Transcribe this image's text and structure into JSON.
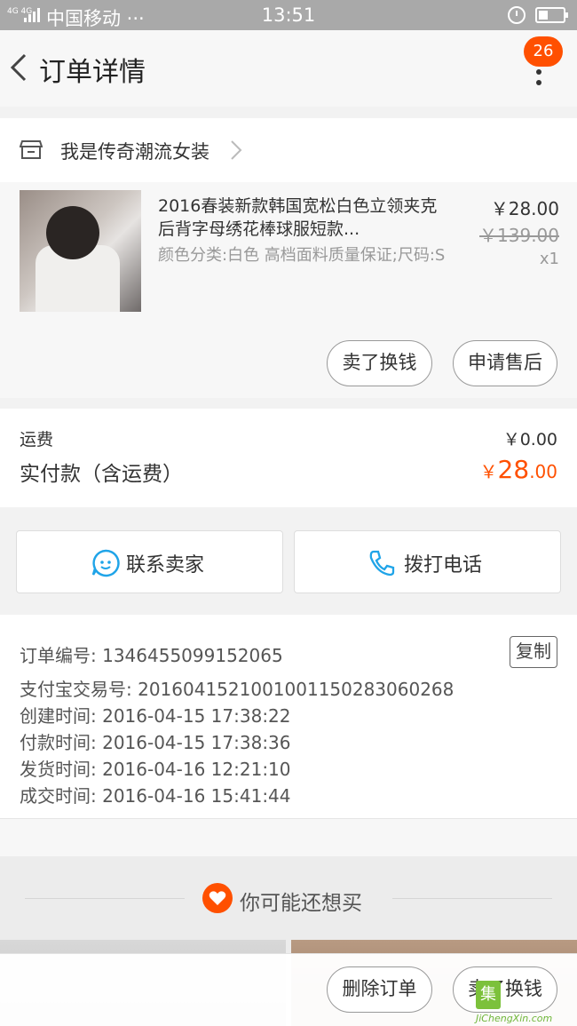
{
  "status_bar": {
    "network": "4G 4G",
    "carrier": "中国移动 ···",
    "time": "13:51"
  },
  "header": {
    "title": "订单详情",
    "badge_count": "26"
  },
  "shop": {
    "name": "我是传奇潮流女装"
  },
  "product": {
    "name": "2016春装新款韩国宽松白色立领夹克后背字母绣花棒球服短款...",
    "sku": "颜色分类:白色 高档面料质量保证;尺码:S",
    "price": "￥28.00",
    "original_price": "￥139.00",
    "quantity": "x1",
    "sell_button": "卖了换钱",
    "after_sale_button": "申请售后"
  },
  "fees": {
    "shipping_label": "运费",
    "shipping_value": "￥0.00",
    "paid_label": "实付款（含运费）",
    "paid_currency": "￥",
    "paid_integer": "28",
    "paid_decimal": ".00"
  },
  "contact": {
    "seller_label": "联系卖家",
    "call_label": "拨打电话"
  },
  "order_info": {
    "order_no": "订单编号: 1346455099152065",
    "copy_label": "复制",
    "alipay_no": "支付宝交易号: 2016041521001001150283060268",
    "created": "创建时间: 2016-04-15 17:38:22",
    "paid": "付款时间: 2016-04-15 17:38:36",
    "shipped": "发货时间: 2016-04-16 12:21:10",
    "completed": "成交时间: 2016-04-16 15:41:44"
  },
  "recommendations": {
    "title": "你可能还想买"
  },
  "bottom_bar": {
    "delete_button": "删除订单",
    "sell_button": "卖了换钱"
  },
  "watermark": {
    "logo_char": "集",
    "url": "JiChengXin.com"
  },
  "colors": {
    "accent": "#ff5000",
    "status_bar": "#a9a9a9",
    "contact_icon": "#1fa4e8"
  },
  "icons": [
    "back-arrow-icon",
    "more-vertical-icon",
    "shop-icon",
    "chevron-right-icon",
    "chat-face-icon",
    "phone-icon",
    "heart-icon",
    "alarm-icon",
    "battery-icon",
    "signal-icon"
  ]
}
